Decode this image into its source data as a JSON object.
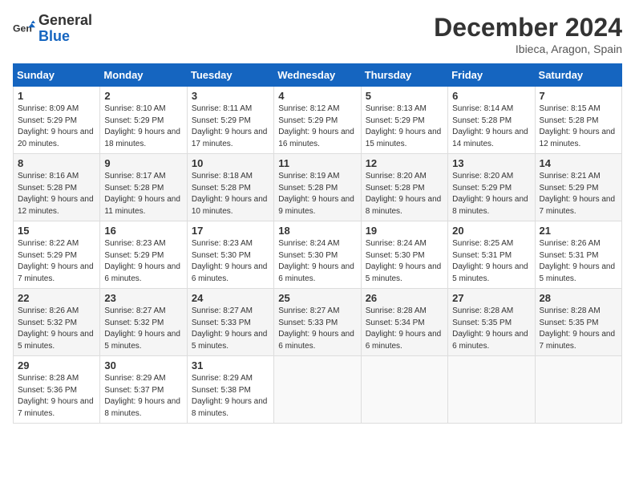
{
  "header": {
    "logo_general": "General",
    "logo_blue": "Blue",
    "month_title": "December 2024",
    "location": "Ibieca, Aragon, Spain"
  },
  "columns": [
    "Sunday",
    "Monday",
    "Tuesday",
    "Wednesday",
    "Thursday",
    "Friday",
    "Saturday"
  ],
  "rows": [
    [
      {
        "day": "1",
        "sunrise": "Sunrise: 8:09 AM",
        "sunset": "Sunset: 5:29 PM",
        "daylight": "Daylight: 9 hours and 20 minutes."
      },
      {
        "day": "2",
        "sunrise": "Sunrise: 8:10 AM",
        "sunset": "Sunset: 5:29 PM",
        "daylight": "Daylight: 9 hours and 18 minutes."
      },
      {
        "day": "3",
        "sunrise": "Sunrise: 8:11 AM",
        "sunset": "Sunset: 5:29 PM",
        "daylight": "Daylight: 9 hours and 17 minutes."
      },
      {
        "day": "4",
        "sunrise": "Sunrise: 8:12 AM",
        "sunset": "Sunset: 5:29 PM",
        "daylight": "Daylight: 9 hours and 16 minutes."
      },
      {
        "day": "5",
        "sunrise": "Sunrise: 8:13 AM",
        "sunset": "Sunset: 5:29 PM",
        "daylight": "Daylight: 9 hours and 15 minutes."
      },
      {
        "day": "6",
        "sunrise": "Sunrise: 8:14 AM",
        "sunset": "Sunset: 5:28 PM",
        "daylight": "Daylight: 9 hours and 14 minutes."
      },
      {
        "day": "7",
        "sunrise": "Sunrise: 8:15 AM",
        "sunset": "Sunset: 5:28 PM",
        "daylight": "Daylight: 9 hours and 12 minutes."
      }
    ],
    [
      {
        "day": "8",
        "sunrise": "Sunrise: 8:16 AM",
        "sunset": "Sunset: 5:28 PM",
        "daylight": "Daylight: 9 hours and 12 minutes."
      },
      {
        "day": "9",
        "sunrise": "Sunrise: 8:17 AM",
        "sunset": "Sunset: 5:28 PM",
        "daylight": "Daylight: 9 hours and 11 minutes."
      },
      {
        "day": "10",
        "sunrise": "Sunrise: 8:18 AM",
        "sunset": "Sunset: 5:28 PM",
        "daylight": "Daylight: 9 hours and 10 minutes."
      },
      {
        "day": "11",
        "sunrise": "Sunrise: 8:19 AM",
        "sunset": "Sunset: 5:28 PM",
        "daylight": "Daylight: 9 hours and 9 minutes."
      },
      {
        "day": "12",
        "sunrise": "Sunrise: 8:20 AM",
        "sunset": "Sunset: 5:28 PM",
        "daylight": "Daylight: 9 hours and 8 minutes."
      },
      {
        "day": "13",
        "sunrise": "Sunrise: 8:20 AM",
        "sunset": "Sunset: 5:29 PM",
        "daylight": "Daylight: 9 hours and 8 minutes."
      },
      {
        "day": "14",
        "sunrise": "Sunrise: 8:21 AM",
        "sunset": "Sunset: 5:29 PM",
        "daylight": "Daylight: 9 hours and 7 minutes."
      }
    ],
    [
      {
        "day": "15",
        "sunrise": "Sunrise: 8:22 AM",
        "sunset": "Sunset: 5:29 PM",
        "daylight": "Daylight: 9 hours and 7 minutes."
      },
      {
        "day": "16",
        "sunrise": "Sunrise: 8:23 AM",
        "sunset": "Sunset: 5:29 PM",
        "daylight": "Daylight: 9 hours and 6 minutes."
      },
      {
        "day": "17",
        "sunrise": "Sunrise: 8:23 AM",
        "sunset": "Sunset: 5:30 PM",
        "daylight": "Daylight: 9 hours and 6 minutes."
      },
      {
        "day": "18",
        "sunrise": "Sunrise: 8:24 AM",
        "sunset": "Sunset: 5:30 PM",
        "daylight": "Daylight: 9 hours and 6 minutes."
      },
      {
        "day": "19",
        "sunrise": "Sunrise: 8:24 AM",
        "sunset": "Sunset: 5:30 PM",
        "daylight": "Daylight: 9 hours and 5 minutes."
      },
      {
        "day": "20",
        "sunrise": "Sunrise: 8:25 AM",
        "sunset": "Sunset: 5:31 PM",
        "daylight": "Daylight: 9 hours and 5 minutes."
      },
      {
        "day": "21",
        "sunrise": "Sunrise: 8:26 AM",
        "sunset": "Sunset: 5:31 PM",
        "daylight": "Daylight: 9 hours and 5 minutes."
      }
    ],
    [
      {
        "day": "22",
        "sunrise": "Sunrise: 8:26 AM",
        "sunset": "Sunset: 5:32 PM",
        "daylight": "Daylight: 9 hours and 5 minutes."
      },
      {
        "day": "23",
        "sunrise": "Sunrise: 8:27 AM",
        "sunset": "Sunset: 5:32 PM",
        "daylight": "Daylight: 9 hours and 5 minutes."
      },
      {
        "day": "24",
        "sunrise": "Sunrise: 8:27 AM",
        "sunset": "Sunset: 5:33 PM",
        "daylight": "Daylight: 9 hours and 5 minutes."
      },
      {
        "day": "25",
        "sunrise": "Sunrise: 8:27 AM",
        "sunset": "Sunset: 5:33 PM",
        "daylight": "Daylight: 9 hours and 6 minutes."
      },
      {
        "day": "26",
        "sunrise": "Sunrise: 8:28 AM",
        "sunset": "Sunset: 5:34 PM",
        "daylight": "Daylight: 9 hours and 6 minutes."
      },
      {
        "day": "27",
        "sunrise": "Sunrise: 8:28 AM",
        "sunset": "Sunset: 5:35 PM",
        "daylight": "Daylight: 9 hours and 6 minutes."
      },
      {
        "day": "28",
        "sunrise": "Sunrise: 8:28 AM",
        "sunset": "Sunset: 5:35 PM",
        "daylight": "Daylight: 9 hours and 7 minutes."
      }
    ],
    [
      {
        "day": "29",
        "sunrise": "Sunrise: 8:28 AM",
        "sunset": "Sunset: 5:36 PM",
        "daylight": "Daylight: 9 hours and 7 minutes."
      },
      {
        "day": "30",
        "sunrise": "Sunrise: 8:29 AM",
        "sunset": "Sunset: 5:37 PM",
        "daylight": "Daylight: 9 hours and 8 minutes."
      },
      {
        "day": "31",
        "sunrise": "Sunrise: 8:29 AM",
        "sunset": "Sunset: 5:38 PM",
        "daylight": "Daylight: 9 hours and 8 minutes."
      },
      null,
      null,
      null,
      null
    ]
  ]
}
